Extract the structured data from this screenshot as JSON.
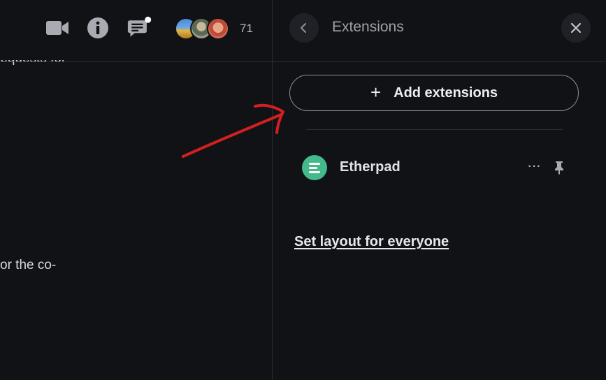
{
  "header": {
    "icons": [
      "video-icon",
      "info-icon",
      "chat-icon"
    ],
    "chat_notification": true,
    "participant_count": "71"
  },
  "left_content": {
    "text_line_1": "requests for",
    "text_line_2": "or the  co-"
  },
  "panel": {
    "title": "Extensions",
    "back_icon": "chevron-left-icon",
    "close_icon": "close-icon",
    "add_button": {
      "icon": "plus-icon",
      "label": "Add extensions"
    },
    "extensions": [
      {
        "name": "Etherpad",
        "icon": "etherpad-icon",
        "icon_color": "#44b98a",
        "more_label": "···",
        "pin_icon": "pin-icon"
      }
    ],
    "layout_link": "Set layout for everyone"
  },
  "annotation": {
    "arrow_color": "#d21f1f"
  },
  "colors": {
    "background": "#111216",
    "divider": "#2a2c31",
    "text": "#dfe1e5"
  }
}
